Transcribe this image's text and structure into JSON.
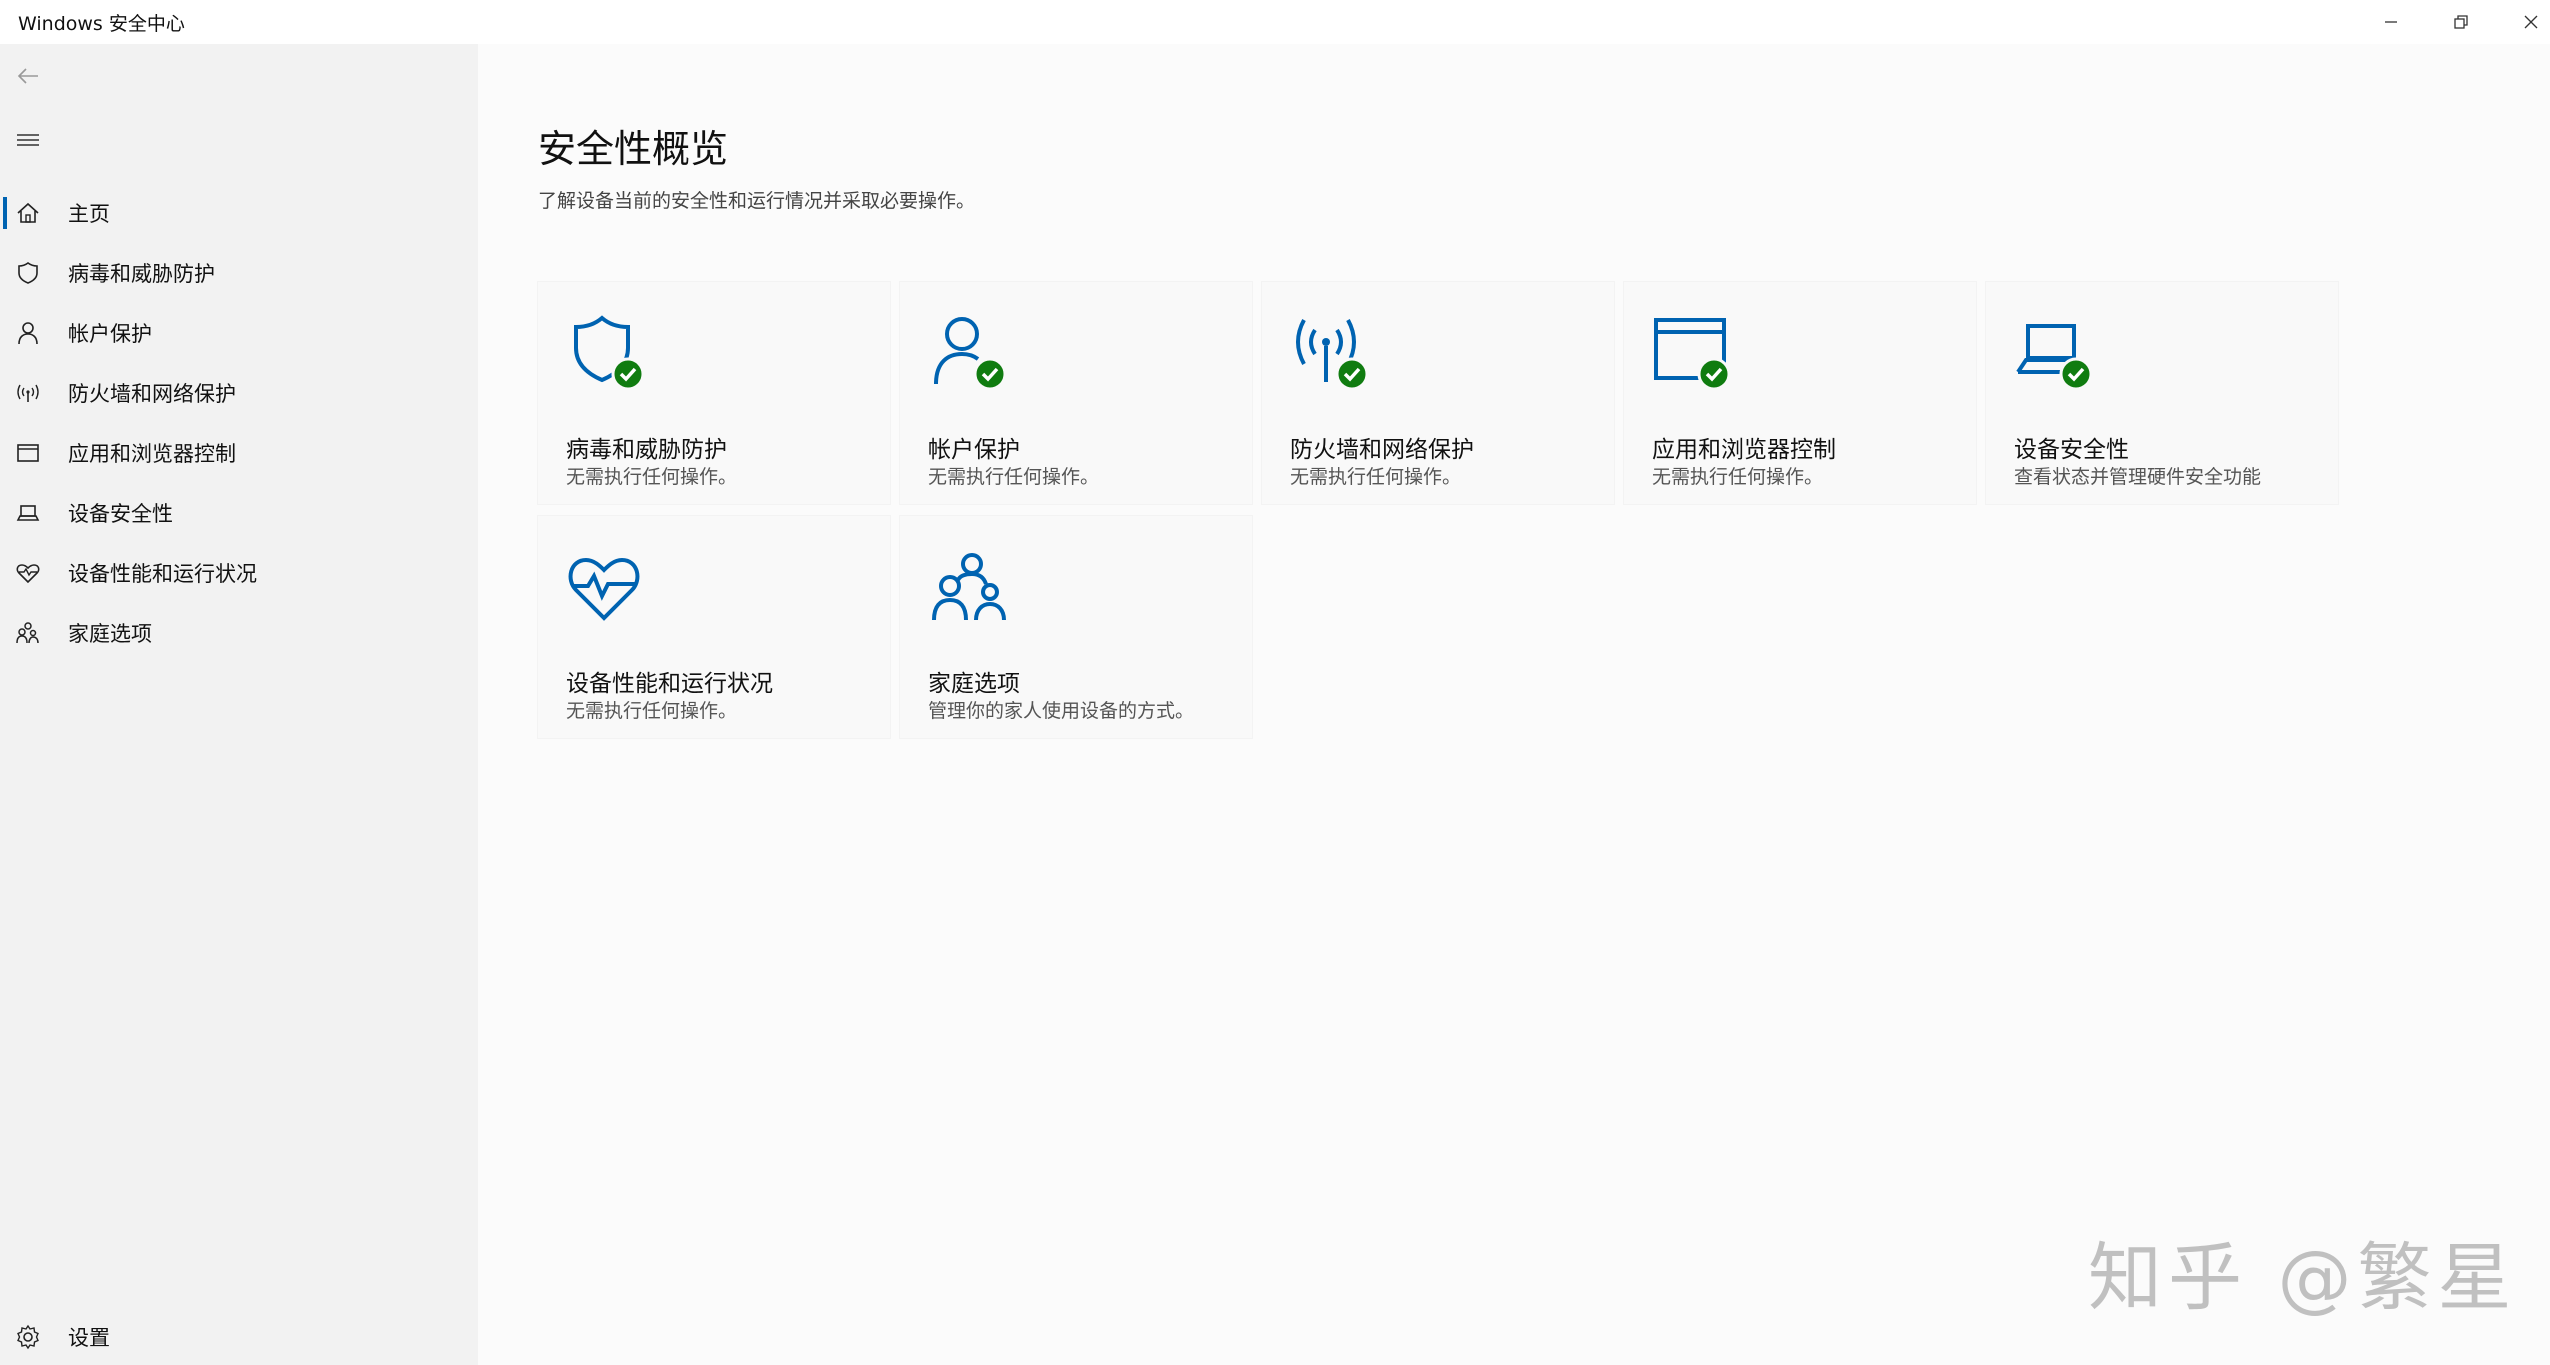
{
  "window": {
    "title": "Windows 安全中心",
    "minimize_icon": "minimize-icon",
    "restore_icon": "restore-icon",
    "close_icon": "close-icon"
  },
  "sidebar": {
    "back_icon": "back-arrow-icon",
    "menu_icon": "hamburger-icon",
    "items": [
      {
        "label": "主页",
        "icon": "home-icon",
        "selected": true
      },
      {
        "label": "病毒和威胁防护",
        "icon": "shield-icon"
      },
      {
        "label": "帐户保护",
        "icon": "person-icon"
      },
      {
        "label": "防火墙和网络保护",
        "icon": "antenna-icon"
      },
      {
        "label": "应用和浏览器控制",
        "icon": "browser-window-icon"
      },
      {
        "label": "设备安全性",
        "icon": "laptop-icon"
      },
      {
        "label": "设备性能和运行状况",
        "icon": "heart-icon"
      },
      {
        "label": "家庭选项",
        "icon": "family-icon"
      }
    ],
    "settings": {
      "label": "设置",
      "icon": "gear-icon"
    }
  },
  "main": {
    "title": "安全性概览",
    "subtitle": "了解设备当前的安全性和运行情况并采取必要操作。",
    "tiles": [
      {
        "title": "病毒和威胁防护",
        "desc": "无需执行任何操作。",
        "icon": "shield-check-icon"
      },
      {
        "title": "帐户保护",
        "desc": "无需执行任何操作。",
        "icon": "person-check-icon"
      },
      {
        "title": "防火墙和网络保护",
        "desc": "无需执行任何操作。",
        "icon": "antenna-check-icon"
      },
      {
        "title": "应用和浏览器控制",
        "desc": "无需执行任何操作。",
        "icon": "browser-check-icon"
      },
      {
        "title": "设备安全性",
        "desc": "查看状态并管理硬件安全功能",
        "icon": "laptop-check-icon"
      },
      {
        "title": "设备性能和运行状况",
        "desc": "无需执行任何操作。",
        "icon": "heart-pulse-icon"
      },
      {
        "title": "家庭选项",
        "desc": "管理你的家人使用设备的方式。",
        "icon": "family-icon"
      }
    ]
  },
  "watermark": "知乎 @繁星",
  "colors": {
    "accent": "#0063b1",
    "status_ok": "#107c10",
    "sidebar_bg": "#f2f2f2",
    "main_bg": "#fbfbfb"
  }
}
